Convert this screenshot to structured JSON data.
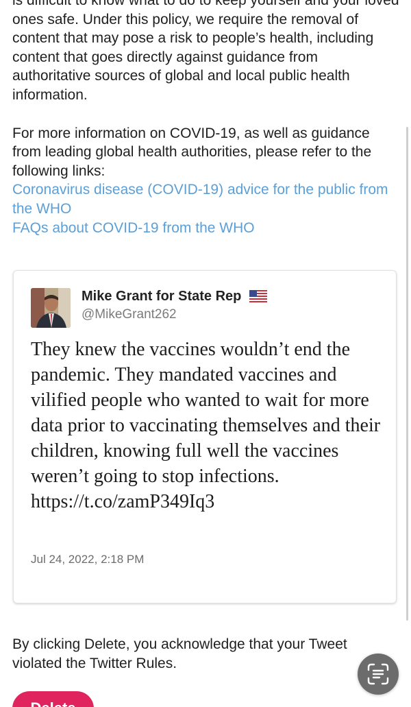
{
  "policy": {
    "paragraph1": "is difficult to know what to do to keep yourself and your loved ones safe. Under this policy, we require the removal of content that may pose a risk to people’s health, including content that goes directly against guidance from authoritative sources of global and local public health information.",
    "paragraph2": "For more information on COVID-19, as well as guidance from leading global health authorities, please refer to the following links:",
    "links": [
      "Coronavirus disease (COVID-19) advice for the public from the WHO",
      "FAQs about COVID-19 from the WHO"
    ]
  },
  "tweet": {
    "author_name": "Mike Grant for State Rep",
    "flag_icon": "us-flag-icon",
    "handle": "@MikeGrant262",
    "text": "They knew the vaccines wouldn’t end the pandemic. They mandated vaccines and vilified people who wanted to wait for more data prior to vaccinating themselves and their children, knowing full well the vaccines weren’t going to stop infections.",
    "link": "https://t.co/zamP349Iq3",
    "timestamp": "Jul 24, 2022, 2:18 PM"
  },
  "footer": {
    "acknowledge_text": "By clicking Delete, you acknowledge that your Tweet violated the Twitter Rules.",
    "delete_label": "Delete"
  },
  "colors": {
    "link": "#5b9fd6",
    "delete_button": "#e0245e",
    "scan_button": "#6c6c6c"
  },
  "icons": {
    "scan_button": "scan-text-icon"
  }
}
